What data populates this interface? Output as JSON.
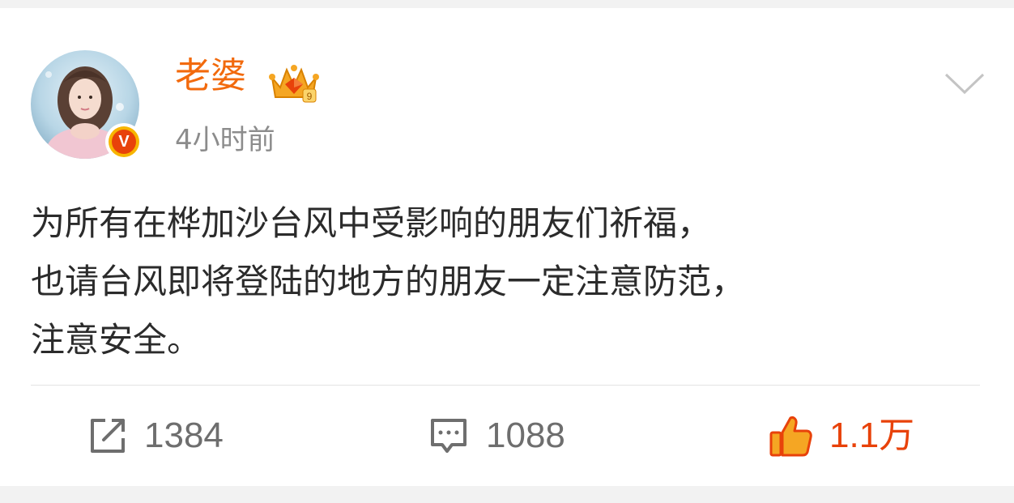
{
  "post": {
    "author": {
      "name": "老婆",
      "verified_badge": "V",
      "crown_badge_level": "9"
    },
    "timestamp": "4小时前",
    "content_lines": [
      "为所有在桦加沙台风中受影响的朋友们祈福，",
      "也请台风即将登陆的地方的朋友一定注意防范，",
      "注意安全。"
    ]
  },
  "actions": {
    "repost": {
      "icon": "share-icon",
      "count": "1384"
    },
    "comment": {
      "icon": "comment-icon",
      "count": "1088"
    },
    "like": {
      "icon": "thumbs-up-icon",
      "count": "1.1万"
    }
  },
  "colors": {
    "username": "#f26a0d",
    "like_active": "#e8420a",
    "text": "#2b2b2b",
    "muted": "#8c8c8c"
  }
}
